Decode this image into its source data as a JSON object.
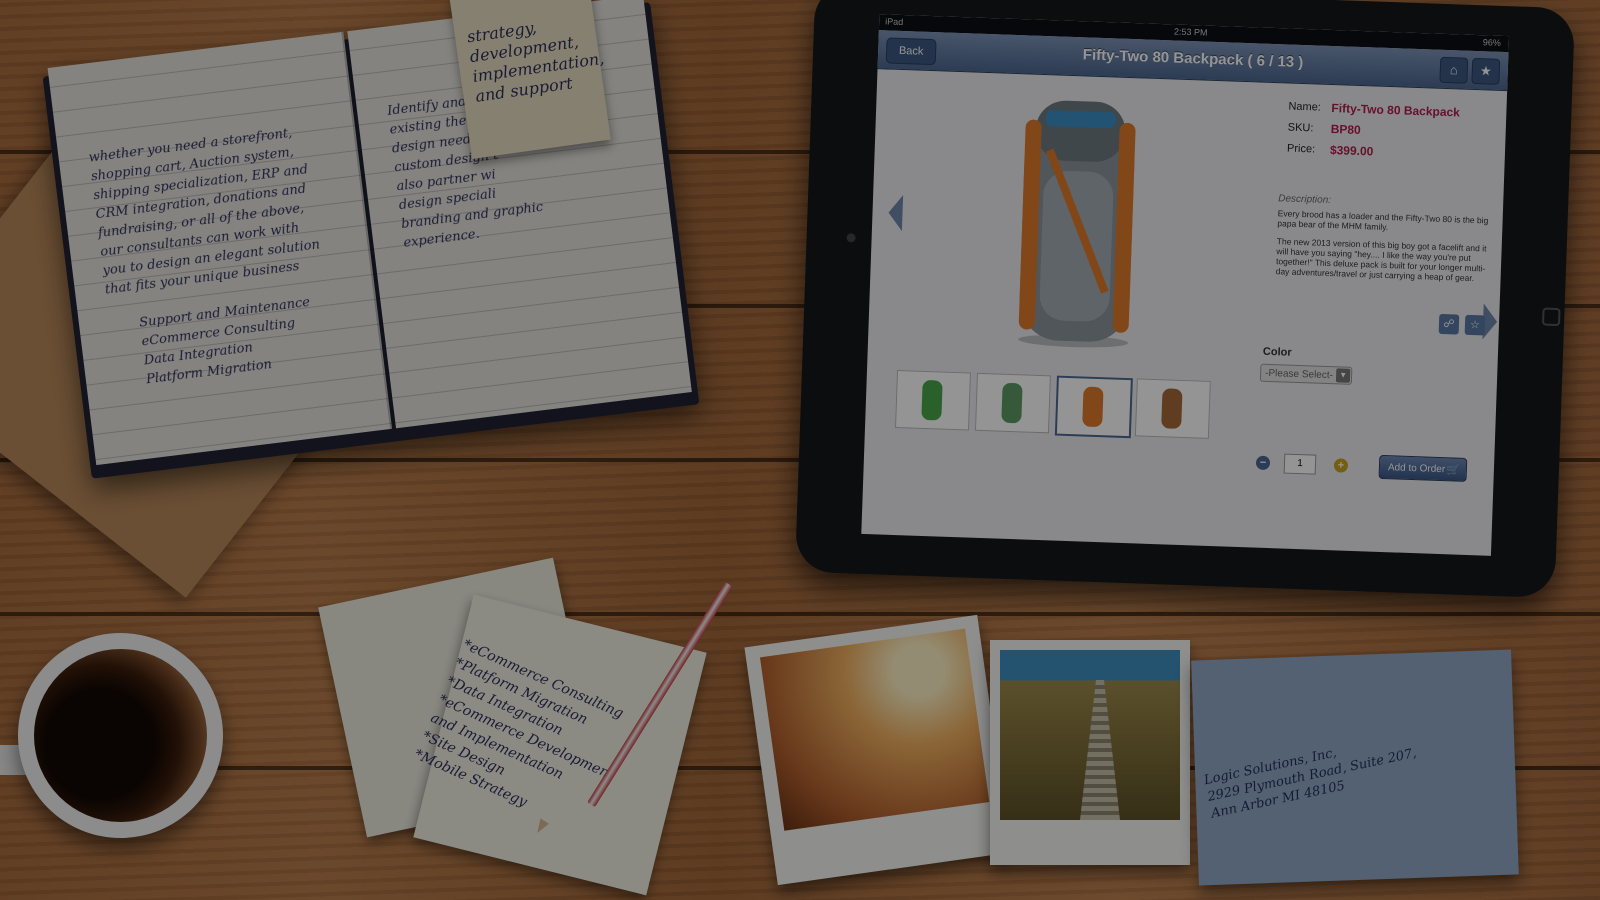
{
  "notebook": {
    "left_page_text": "whether you need a storefront,\nshopping cart, Auction system,\nshipping specialization, ERP and\nCRM integration, donations and\nfundraising, or all of the above,\nour consultants can work with\nyou to design an elegant solution\nthat fits your unique business",
    "left_page_list": "Support and Maintenance\neCommerce Consulting\nData Integration\nPlatform Migration",
    "right_page_text": "Identify and i\nexisting theme\ndesign needs, a\ncustom design t\nalso partner wi\ndesign speciali\nbranding and graphic\nexperience.",
    "tag_text": "strategy,\ndevelopment,\nimplementation,\nand support"
  },
  "tablet": {
    "status": {
      "device": "iPad",
      "time": "2:53 PM",
      "battery": "96%"
    },
    "back_label": "Back",
    "title": "Fifty-Two 80 Backpack  ( 6 / 13 )",
    "home_icon": "home-icon",
    "favorite_icon": "star-icon",
    "product": {
      "name_label": "Name:",
      "name": "Fifty-Two 80 Backpack",
      "sku_label": "SKU:",
      "sku": "BP80",
      "price_label": "Price:",
      "price": "$399.00",
      "description_heading": "Description:",
      "description_1": "Every brood has a loader and the Fifty-Two 80 is the big papa bear of the MHM family.",
      "description_2": "The new 2013 version of this big boy got a facelift and it will have you saying \"hey.... I like the way you're put together!\" This deluxe pack is built for your longer multi-day adventures/travel or just carrying a heap of gear.",
      "color_label": "Color",
      "color_placeholder": "-Please Select-",
      "quantity": "1",
      "add_to_order_label": "Add to Order"
    },
    "thumbnail_colors": [
      "#49a84a",
      "#5e9c63",
      "#e07a2c",
      "#a56a3a"
    ],
    "accent": "#b01e4b"
  },
  "sticky_note_text": "*eCommerce Consulting\n*Platform Migration\n*Data Integration\n*eCommerce Development\nand Implementation\n*Site Design\n*Mobile Strategy",
  "envelope_text": "Logic Solutions, Inc,\n2929 Plymouth Road, Suite 207,\nAnn Arbor MI 48105"
}
